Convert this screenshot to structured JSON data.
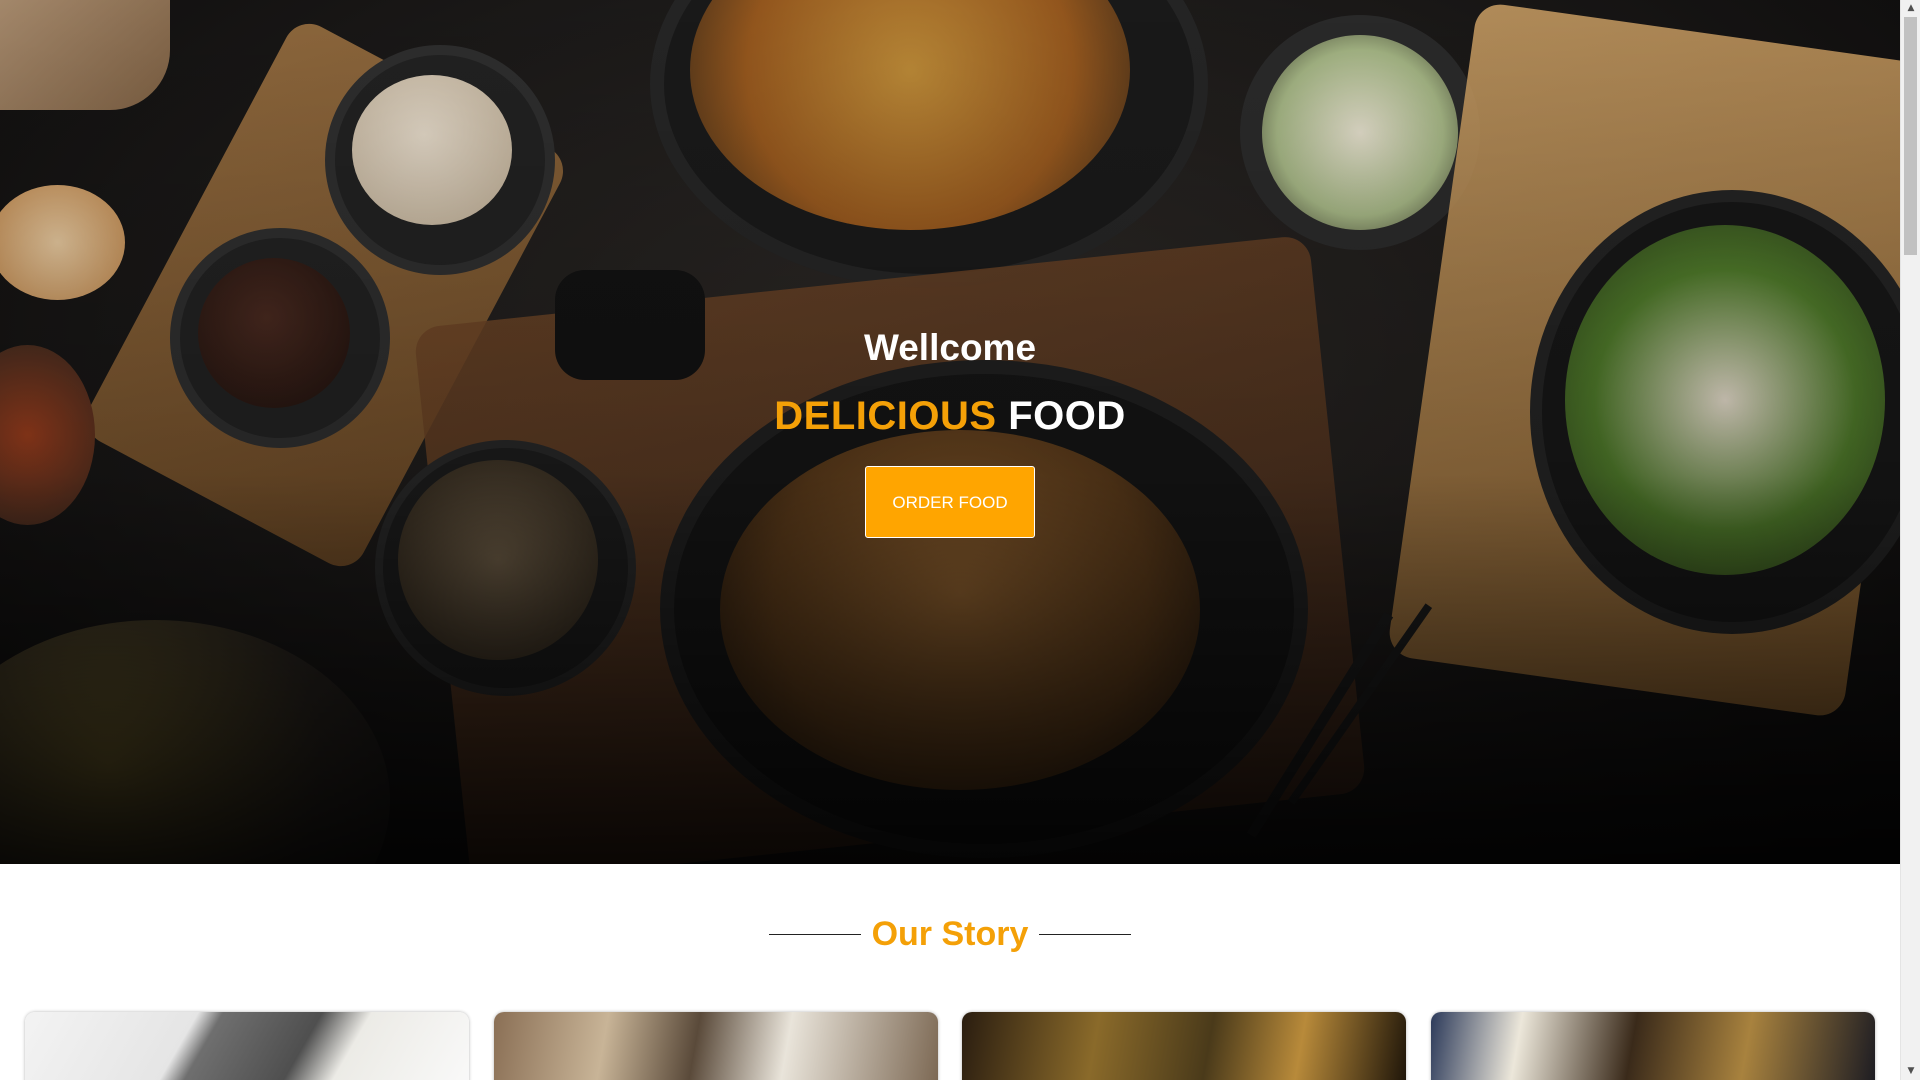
{
  "hero": {
    "welcome": "Wellcome",
    "headline_accent": "DELICIOUS",
    "headline_plain": "FOOD",
    "order_button": "ORDER FOOD"
  },
  "story": {
    "title": "Our Story"
  },
  "colors": {
    "accent": "#f4a007",
    "button": "#ffa500",
    "hero_background": "#1b1918"
  },
  "scrollbar": {
    "up_icon": "triangle-up-icon",
    "down_icon": "triangle-down-icon"
  }
}
